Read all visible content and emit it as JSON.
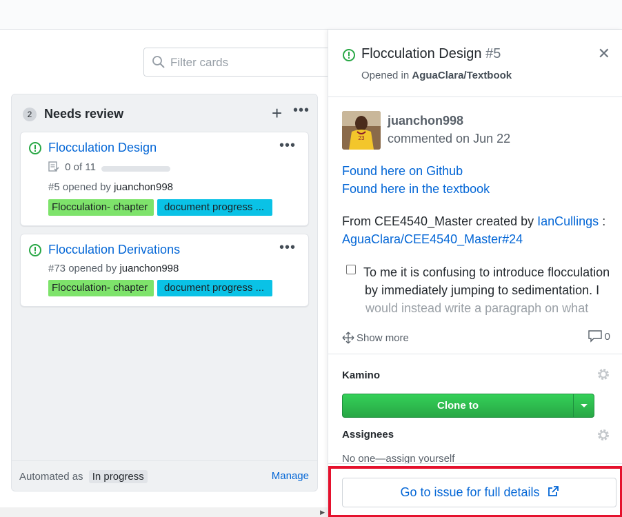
{
  "filter": {
    "placeholder": "Filter cards",
    "icon": "search-icon"
  },
  "column": {
    "count": "2",
    "title": "Needs review",
    "add_icon": "plus-icon",
    "more_icon": "kebab-icon",
    "cards": [
      {
        "title": "Flocculation Design",
        "progress_text": "0 of 11",
        "progress_fraction": 0.0,
        "meta_prefix": "#5 opened by ",
        "user": "juanchon998",
        "labels": [
          {
            "text": "Flocculation- chapter",
            "color": "#7ee36b"
          },
          {
            "text": "document progress ...",
            "color": "#0ac2e6"
          }
        ]
      },
      {
        "title": "Flocculation Derivations",
        "meta_prefix": "#73 opened by ",
        "user": "juanchon998",
        "labels": [
          {
            "text": "Flocculation- chapter",
            "color": "#7ee36b"
          },
          {
            "text": "document progress ...",
            "color": "#0ac2e6"
          }
        ]
      }
    ],
    "footer": {
      "automated_prefix": "Automated as",
      "automated_value": "In progress",
      "manage": "Manage"
    }
  },
  "panel": {
    "title": "Flocculation Design",
    "number": "#5",
    "opened_prefix": "Opened in ",
    "repo": "AguaClara/Textbook",
    "comment": {
      "user": "juanchon998",
      "date": "commented on Jun 22",
      "link1": "Found here on Github",
      "link2": "Found here in the textbook",
      "from_text": "From CEE4540_Master created by ",
      "from_user": "IanCullings",
      "from_sep": " :",
      "ref_link": "AguaClara/CEE4540_Master#24",
      "task_line1": "To me it is confusing to introduce flocculation",
      "task_line2": "by immediately jumping to sedimentation. I",
      "task_line3": "would instead write a paragraph on what",
      "show_more": "Show more",
      "comment_count": "0"
    },
    "kamino": {
      "title": "Kamino",
      "clone_label": "Clone to"
    },
    "assignees": {
      "title": "Assignees",
      "value": "No one—assign yourself"
    },
    "goto": "Go to issue for full details"
  },
  "colors": {
    "accent": "#0366d6",
    "open_issue": "#28a745",
    "highlight": "#e5112d"
  }
}
